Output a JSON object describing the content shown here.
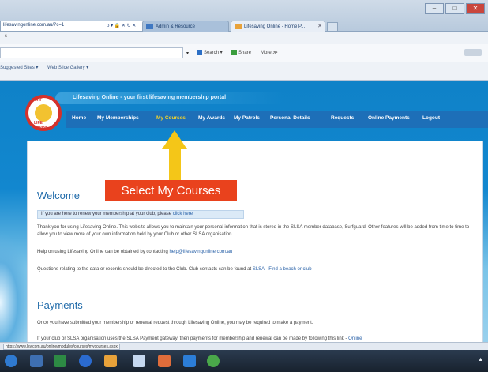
{
  "browser": {
    "address": "lifesavingonline.com.au/?c=1 ",
    "address_glyphs": "ρ ▾ 🔒 ✕ ↻ ✕",
    "tabs": [
      {
        "label": "Admin & Resource"
      },
      {
        "label": "Lifesaving Online - Home P..."
      }
    ],
    "tab_close": "✕",
    "window_buttons": [
      "–",
      "□",
      "✕"
    ],
    "menu_dots": "s",
    "search_drop": "▾",
    "cmd_items": [
      "Search ▾",
      "Share",
      "More ≫"
    ],
    "favorites": [
      "Suggested Sites ▾",
      "Web Slice Gallery ▾"
    ],
    "status": "https://www.lsv.com.au/online/modules/courses/mycourses.aspx"
  },
  "site": {
    "tagline": "Lifesaving Online - your first lifesaving membership portal",
    "logo_top": "SURF",
    "logo_bottom": "LIFE SAVING",
    "nav": [
      {
        "label": "Home",
        "active": false
      },
      {
        "label": "My Memberships",
        "active": false
      },
      {
        "label": "My Courses",
        "active": true
      },
      {
        "label": "My Awards",
        "active": false
      },
      {
        "label": "My Patrols",
        "active": false
      },
      {
        "label": "Personal Details",
        "active": false
      },
      {
        "label": "Requests",
        "active": false
      },
      {
        "label": "Online Payments",
        "active": false
      },
      {
        "label": "Logout",
        "active": false
      }
    ],
    "welcome_heading": "Welcome",
    "renew_text": "If you are here to renew your membership at your club, please",
    "renew_link": "click here",
    "para1": "Thank you for using Lifesaving Online. This website allows you to maintain your personal information that is stored in the SLSA member database, Surfguard. Other features will be added from time to time to allow you to view more of your own information held by your Club or other SLSA organisation.",
    "para2_text": "Help on using Lifesaving Online can be obtained by contacting",
    "para2_link": "help@lifesavingonline.com.au",
    "para3_text": "Questions relating to the data or records should be directed to the Club. Club contacts can be found at",
    "para3_link": "SLSA - Find a beach or club",
    "payments_heading": "Payments",
    "para4": "Once you have submitted your membership or renewal request through Lifesaving Online, you may be required to make a payment.",
    "para5_text": "If your club or SLSA organisation uses the SLSA Payment gateway, then payments for membership and renewal can be made by following this link -",
    "para5_link": "Online"
  },
  "annotation": {
    "callout": "Select My Courses",
    "arrow_color": "#f4c618",
    "callout_color": "#e9421d"
  },
  "taskbar": {
    "clock": "▲"
  }
}
